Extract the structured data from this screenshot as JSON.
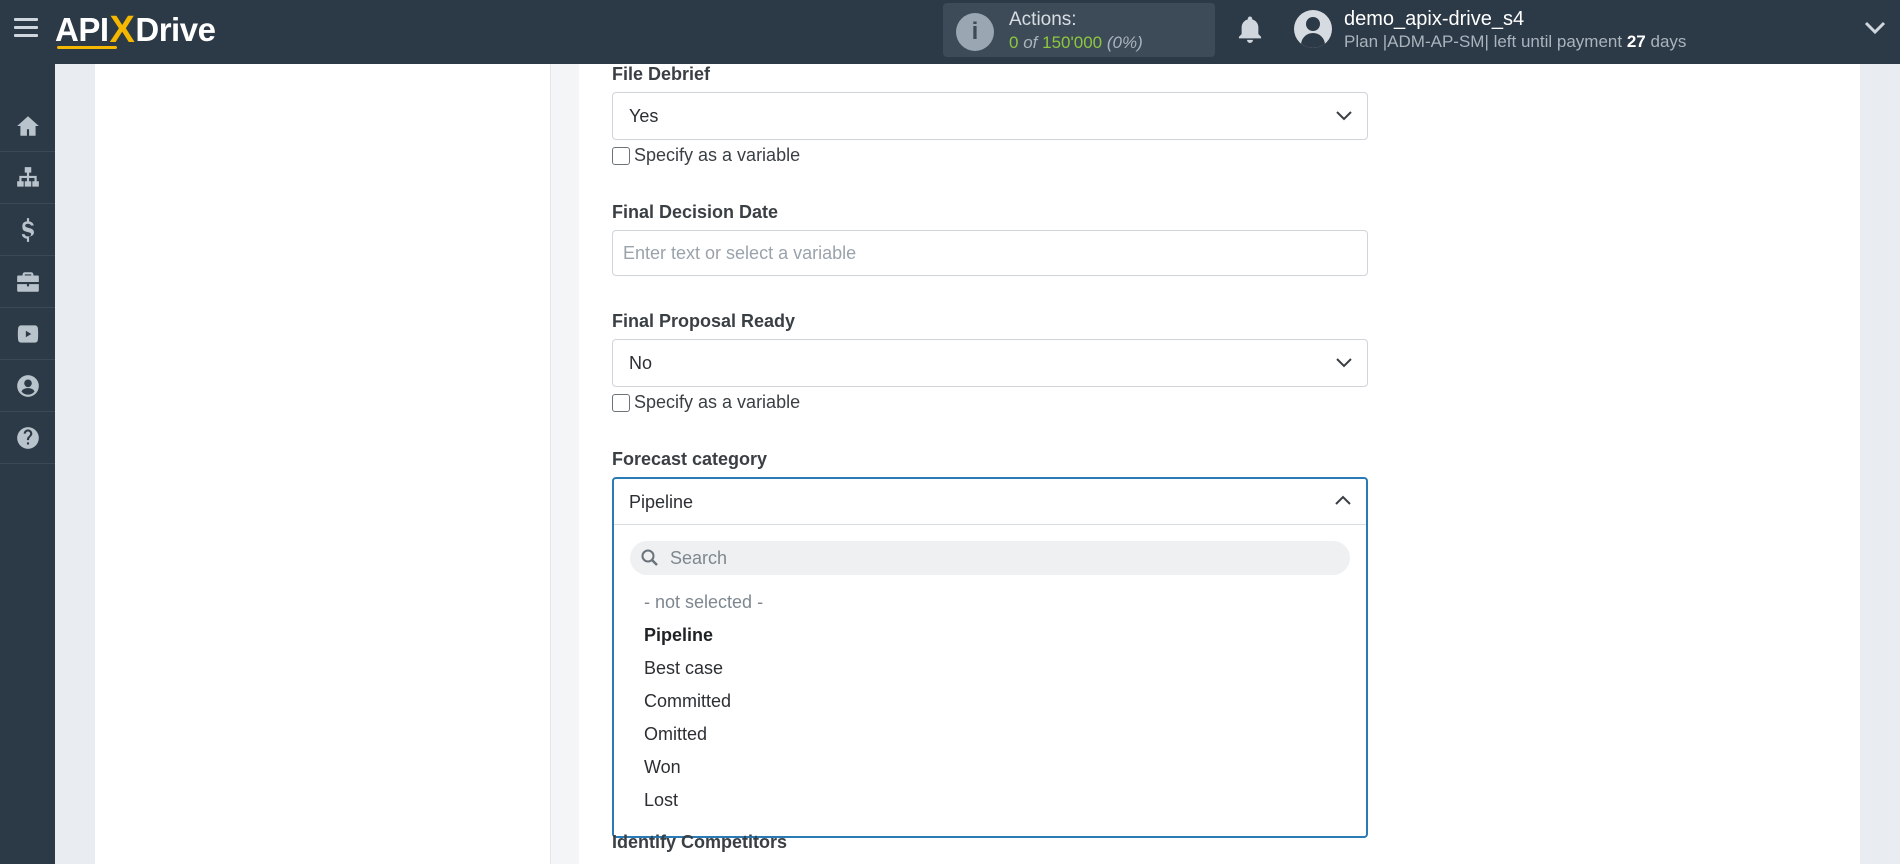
{
  "header": {
    "logo_left": "API",
    "logo_x": "X",
    "logo_right": "Drive",
    "actions_label": "Actions:",
    "actions_used": "0",
    "actions_of": "of",
    "actions_total": "150'000",
    "actions_percent": "(0%)",
    "user_name": "demo_apix-drive_s4",
    "plan_text": "Plan |ADM-AP-SM| left until payment",
    "days_left": "27",
    "days_unit": "days"
  },
  "sidebar": {
    "items": [
      {
        "icon": "home-icon"
      },
      {
        "icon": "sitemap-icon"
      },
      {
        "icon": "dollar-icon"
      },
      {
        "icon": "briefcase-icon"
      },
      {
        "icon": "youtube-icon"
      },
      {
        "icon": "user-circle-icon"
      },
      {
        "icon": "help-circle-icon"
      }
    ]
  },
  "form": {
    "file_debrief": {
      "label": "File Debrief",
      "value": "Yes",
      "checkbox_label": "Specify as a variable"
    },
    "final_decision_date": {
      "label": "Final Decision Date",
      "placeholder": "Enter text or select a variable",
      "value": ""
    },
    "final_proposal_ready": {
      "label": "Final Proposal Ready",
      "value": "No",
      "checkbox_label": "Specify as a variable"
    },
    "forecast_category": {
      "label": "Forecast category",
      "value": "Pipeline",
      "search_placeholder": "Search",
      "options": [
        {
          "label": "- not selected -",
          "state": "muted"
        },
        {
          "label": "Pipeline",
          "state": "selected"
        },
        {
          "label": "Best case",
          "state": "normal"
        },
        {
          "label": "Committed",
          "state": "normal"
        },
        {
          "label": "Omitted",
          "state": "normal"
        },
        {
          "label": "Won",
          "state": "normal"
        },
        {
          "label": "Lost",
          "state": "normal"
        }
      ]
    },
    "identify_competitors": {
      "label": "Identify Competitors"
    }
  },
  "colors": {
    "topbar": "#2c3946",
    "accent_yellow": "#f5b800",
    "focus_blue": "#2a7bb5",
    "actions_green": "#8dc73f"
  }
}
